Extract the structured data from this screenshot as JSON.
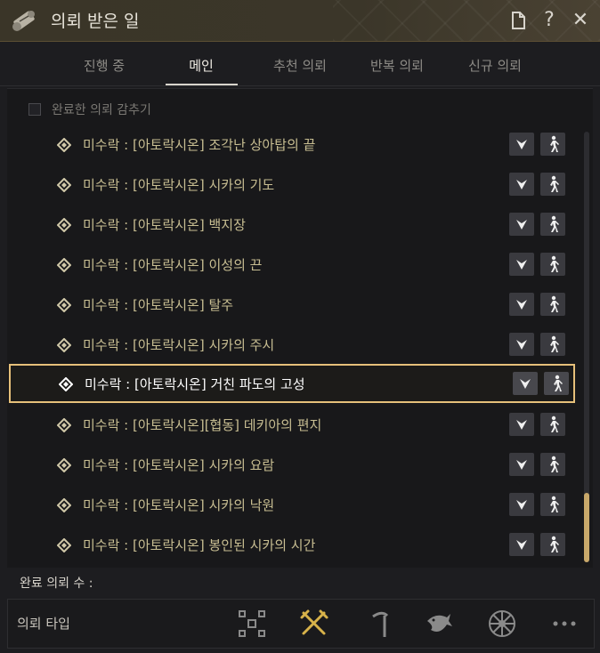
{
  "window": {
    "title": "의뢰 받은 일",
    "icons": [
      "scroll-quest-icon",
      "document-icon",
      "help-icon",
      "close-icon"
    ],
    "help_glyph": "?",
    "close_glyph": "✕"
  },
  "tabs": [
    {
      "label": "진행 중",
      "active": false
    },
    {
      "label": "메인",
      "active": true
    },
    {
      "label": "추천 의뢰",
      "active": false
    },
    {
      "label": "반복 의뢰",
      "active": false
    },
    {
      "label": "신규 의뢰",
      "active": false
    }
  ],
  "list": {
    "hide_completed_label": "완료한 의뢰 감추기",
    "hide_completed_checked": false,
    "items": [
      {
        "text": "미수락 : [아토락시온] 조각난 상아탑의 끝",
        "selected": false
      },
      {
        "text": "미수락 : [아토락시온] 시카의 기도",
        "selected": false
      },
      {
        "text": "미수락 : [아토락시온] 백지장",
        "selected": false
      },
      {
        "text": "미수락 : [아토락시온] 이성의 끈",
        "selected": false
      },
      {
        "text": "미수락 : [아토락시온] 탈주",
        "selected": false
      },
      {
        "text": "미수락 : [아토락시온] 시카의 주시",
        "selected": false
      },
      {
        "text": "미수락 : [아토락시온] 거친 파도의 고성",
        "selected": true
      },
      {
        "text": "미수락 : [아토락시온][협동] 데키아의 편지",
        "selected": false
      },
      {
        "text": "미수락 : [아토락시온] 시카의 요람",
        "selected": false
      },
      {
        "text": "미수락 : [아토락시온] 시카의 낙원",
        "selected": false
      },
      {
        "text": "미수락 : [아토락시온] 봉인된 시카의 시간",
        "selected": false
      }
    ],
    "scroll_position_fraction": 0.84
  },
  "footer": {
    "completed_label": "완료 의뢰 수 :",
    "type_label": "의뢰 타입",
    "type_icons": [
      "grid-squares-icon",
      "crossed-swords-icon",
      "pickaxe-icon",
      "fish-icon",
      "wheel-icon",
      "more-dots-icon"
    ],
    "accent_color": "#d7b24a",
    "gold_color": "#e6c07a"
  }
}
